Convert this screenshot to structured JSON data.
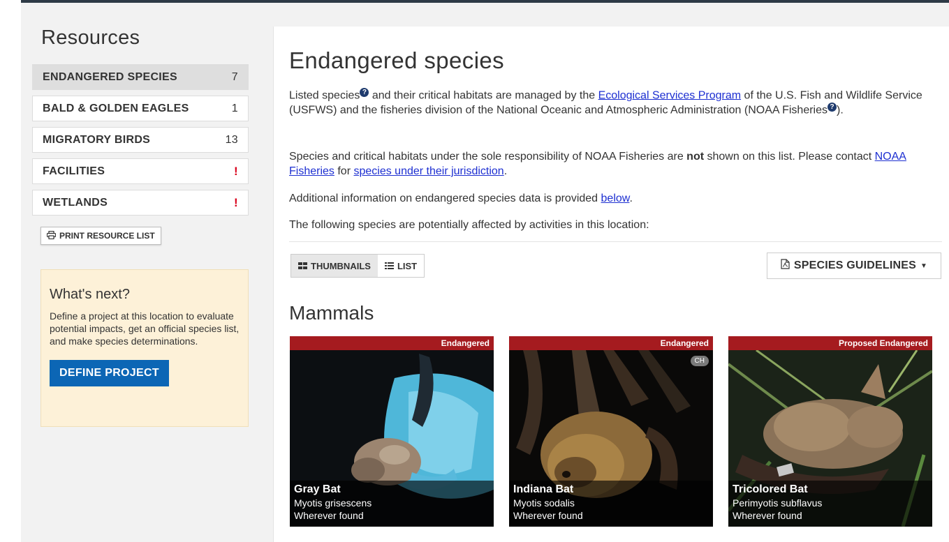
{
  "sidebar": {
    "title": "Resources",
    "items": [
      {
        "label": "ENDANGERED SPECIES",
        "count": "7"
      },
      {
        "label": "BALD & GOLDEN EAGLES",
        "count": "1"
      },
      {
        "label": "MIGRATORY BIRDS",
        "count": "13"
      },
      {
        "label": "FACILITIES",
        "count": "!"
      },
      {
        "label": "WETLANDS",
        "count": "!"
      }
    ],
    "print_label": "PRINT RESOURCE LIST",
    "whats_next": {
      "title": "What's next?",
      "text": "Define a project at this location to evaluate potential impacts, get an official species list, and make species determinations.",
      "button": "DEFINE PROJECT"
    }
  },
  "main": {
    "title": "Endangered species",
    "p1": {
      "a": "Listed species",
      "b": " and their critical habitats are managed by the ",
      "link1": "Ecological Services Program",
      "c": " of the U.S. Fish and Wildlife Service (USFWS) and the fisheries division of the National Oceanic and Atmospheric Administration (NOAA Fisheries",
      "d": ")."
    },
    "p2": {
      "a": "Species and critical habitats under the sole responsibility of NOAA Fisheries are ",
      "bold": "not",
      "b": " shown on this list. Please contact ",
      "link1": "NOAA Fisheries",
      "c": " for ",
      "link2": "species under their jurisdiction",
      "d": "."
    },
    "p3": {
      "a": "Additional information on endangered species data is provided ",
      "link": "below",
      "b": "."
    },
    "p4": "The following species are potentially affected by activities in this location:",
    "view_toggle": {
      "thumbnails": "THUMBNAILS",
      "list": "LIST"
    },
    "guidelines": "SPECIES GUIDELINES",
    "group": "Mammals",
    "species": [
      {
        "status": "Endangered",
        "name": "Gray Bat",
        "scientific": "Myotis grisescens",
        "range": "Wherever found",
        "badge": ""
      },
      {
        "status": "Endangered",
        "name": "Indiana Bat",
        "scientific": "Myotis sodalis",
        "range": "Wherever found",
        "badge": "CH"
      },
      {
        "status": "Proposed Endangered",
        "name": "Tricolored Bat",
        "scientific": "Perimyotis subflavus",
        "range": "Wherever found",
        "badge": ""
      }
    ]
  },
  "colors": {
    "status_red": "#a51b1f",
    "primary_blue": "#0c66b5",
    "warn_red": "#d9001b",
    "link": "#1d2fd1"
  }
}
